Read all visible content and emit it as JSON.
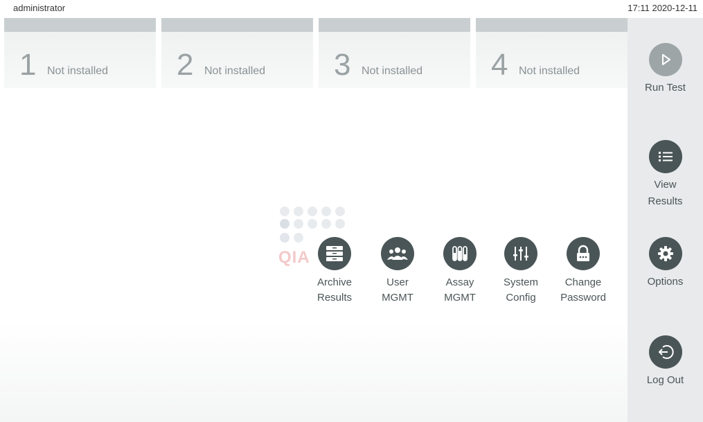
{
  "status_bar": {
    "user": "administrator",
    "datetime": "17:11 2020-12-11"
  },
  "modules": [
    {
      "number": "1",
      "status": "Not installed"
    },
    {
      "number": "2",
      "status": "Not installed"
    },
    {
      "number": "3",
      "status": "Not installed"
    },
    {
      "number": "4",
      "status": "Not installed"
    }
  ],
  "watermark": {
    "text": "QIA"
  },
  "tools": [
    {
      "line1": "Archive",
      "line2": "Results",
      "icon": "archive-icon"
    },
    {
      "line1": "User",
      "line2": "MGMT",
      "icon": "users-icon"
    },
    {
      "line1": "Assay",
      "line2": "MGMT",
      "icon": "test-tubes-icon"
    },
    {
      "line1": "System",
      "line2": "Config",
      "icon": "sliders-icon"
    },
    {
      "line1": "Change",
      "line2": "Password",
      "icon": "lock-icon"
    }
  ],
  "sidebar": {
    "run_test": {
      "label": "Run Test",
      "icon": "play-icon",
      "enabled": false
    },
    "view_results": {
      "line1": "View",
      "line2": "Results",
      "icon": "list-icon"
    },
    "options": {
      "label": "Options",
      "icon": "gear-icon"
    },
    "log_out": {
      "label": "Log Out",
      "icon": "logout-icon"
    }
  },
  "colors": {
    "icon_bg": "#4a5557",
    "icon_disabled_bg": "#9ea5a7",
    "sidebar_bg": "#e8eaeb",
    "module_header": "#c9cfd1"
  }
}
